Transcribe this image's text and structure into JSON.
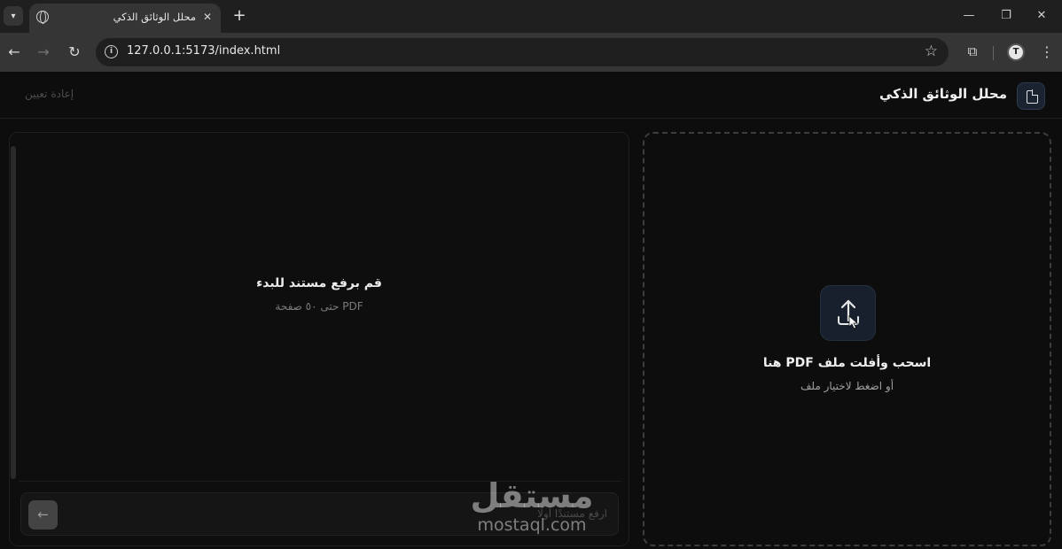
{
  "browser": {
    "tab_title": "محلل الوثائق الذكي",
    "url": "127.0.0.1:5173/index.html",
    "profile_initial": "T"
  },
  "header": {
    "title": "محلل الوثائق الذكي",
    "reset_label": "إعادة تعيين"
  },
  "chat": {
    "empty_title": "قم برفع مستند للبدء",
    "empty_subtitle": "PDF حتى ٥٠ صفحة",
    "input_placeholder": "ارفع مستندًا أولًا"
  },
  "dropzone": {
    "title": "اسحب وأفلت ملف PDF هنا",
    "subtitle": "أو اضغط لاختيار ملف"
  },
  "watermark": {
    "arabic": "مستقل",
    "latin": "mostaql.com"
  },
  "colors": {
    "background": "#0d0d0d",
    "accent_box": "#18202d",
    "dashed_border": "#3d3d3d"
  }
}
